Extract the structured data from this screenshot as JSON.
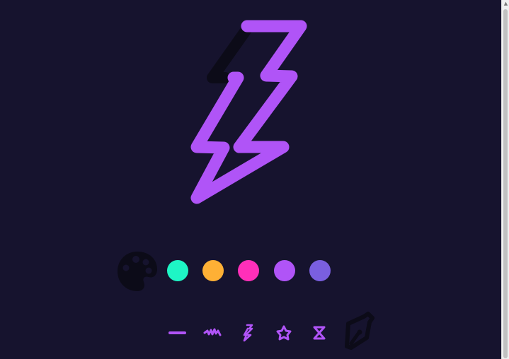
{
  "app": {
    "canvas_name": "drawing-canvas"
  },
  "colors": {
    "background": "#16132e",
    "stroke_primary": "#b054f7",
    "shadow_stroke": "#0c0b18",
    "palette_icon": "#0c0b18"
  },
  "palette": {
    "icon": "palette-icon",
    "swatches": [
      {
        "name": "swatch-teal",
        "color": "#1ef5c5"
      },
      {
        "name": "swatch-orange",
        "color": "#feb035"
      },
      {
        "name": "swatch-pink",
        "color": "#ff2fb9"
      },
      {
        "name": "swatch-purple",
        "color": "#b054f7"
      },
      {
        "name": "swatch-indigo",
        "color": "#7a5fe0"
      }
    ]
  },
  "tools": [
    {
      "name": "line-tool-icon"
    },
    {
      "name": "scribble-tool-icon"
    },
    {
      "name": "zigzag-tool-icon"
    },
    {
      "name": "star-tool-icon"
    },
    {
      "name": "hourglass-tool-icon"
    },
    {
      "name": "pen-tool-icon"
    }
  ]
}
